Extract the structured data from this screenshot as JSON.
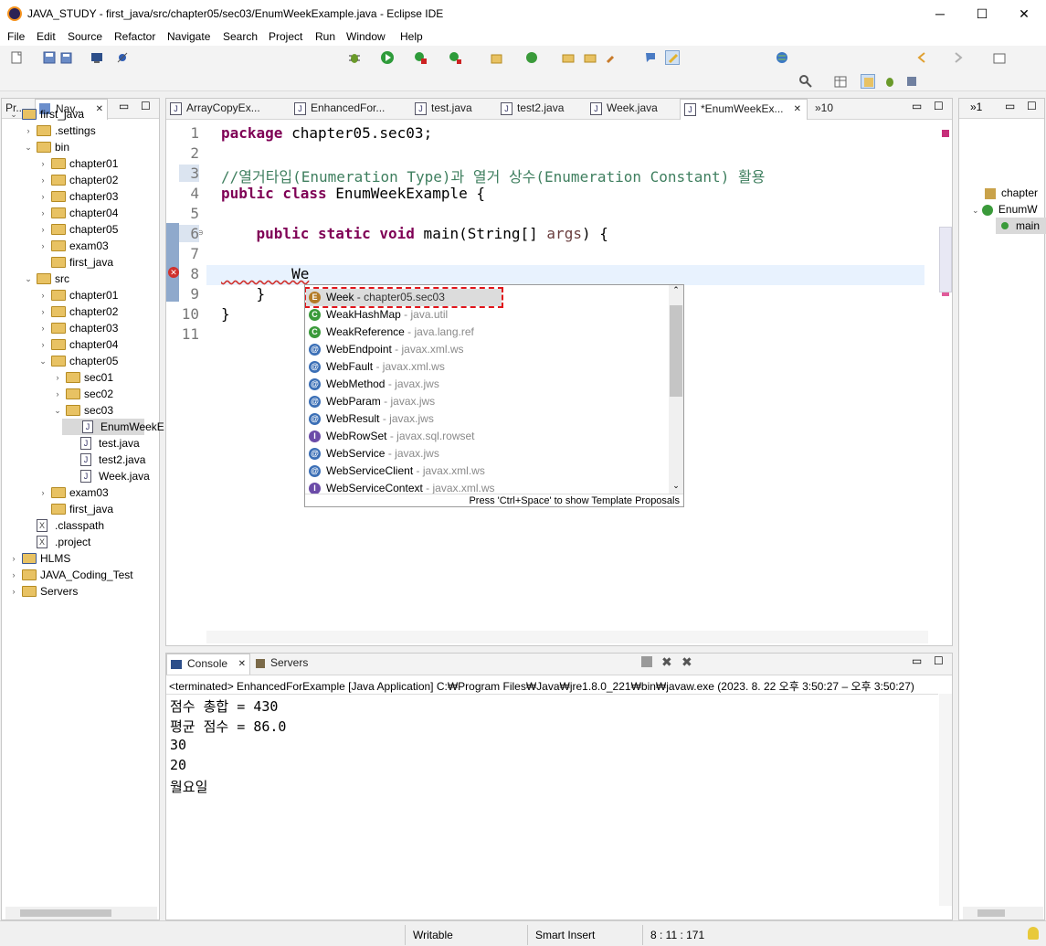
{
  "window": {
    "title": "JAVA_STUDY - first_java/src/chapter05/sec03/EnumWeekExample.java - Eclipse IDE",
    "minimize": "─",
    "maximize": "☐",
    "close": "✕"
  },
  "menu": [
    "File",
    "Edit",
    "Source",
    "Refactor",
    "Navigate",
    "Search",
    "Project",
    "Run",
    "Window",
    "Help"
  ],
  "left_panel": {
    "tabs": [
      "Pr...",
      "Nav..."
    ],
    "tree": [
      {
        "label": "first_java",
        "level": 0,
        "expanded": true,
        "kind": "project"
      },
      {
        "label": ".settings",
        "level": 1,
        "expanded": false,
        "kind": "folder"
      },
      {
        "label": "bin",
        "level": 1,
        "expanded": true,
        "kind": "folder"
      },
      {
        "label": "chapter01",
        "level": 2,
        "expanded": false,
        "kind": "folder"
      },
      {
        "label": "chapter02",
        "level": 2,
        "expanded": false,
        "kind": "folder"
      },
      {
        "label": "chapter03",
        "level": 2,
        "expanded": false,
        "kind": "folder"
      },
      {
        "label": "chapter04",
        "level": 2,
        "expanded": false,
        "kind": "folder"
      },
      {
        "label": "chapter05",
        "level": 2,
        "expanded": false,
        "kind": "folder"
      },
      {
        "label": "exam03",
        "level": 2,
        "expanded": false,
        "kind": "folder"
      },
      {
        "label": "first_java",
        "level": 2,
        "expanded": null,
        "kind": "folder"
      },
      {
        "label": "src",
        "level": 1,
        "expanded": true,
        "kind": "folder"
      },
      {
        "label": "chapter01",
        "level": 2,
        "expanded": false,
        "kind": "folder"
      },
      {
        "label": "chapter02",
        "level": 2,
        "expanded": false,
        "kind": "folder"
      },
      {
        "label": "chapter03",
        "level": 2,
        "expanded": false,
        "kind": "folder"
      },
      {
        "label": "chapter04",
        "level": 2,
        "expanded": false,
        "kind": "folder"
      },
      {
        "label": "chapter05",
        "level": 2,
        "expanded": true,
        "kind": "folder"
      },
      {
        "label": "sec01",
        "level": 3,
        "expanded": false,
        "kind": "folder"
      },
      {
        "label": "sec02",
        "level": 3,
        "expanded": false,
        "kind": "folder"
      },
      {
        "label": "sec03",
        "level": 3,
        "expanded": true,
        "kind": "folder"
      },
      {
        "label": "EnumWeekE",
        "level": 4,
        "expanded": null,
        "kind": "java",
        "selected": true
      },
      {
        "label": "test.java",
        "level": 4,
        "expanded": null,
        "kind": "java"
      },
      {
        "label": "test2.java",
        "level": 4,
        "expanded": null,
        "kind": "java"
      },
      {
        "label": "Week.java",
        "level": 4,
        "expanded": null,
        "kind": "java"
      },
      {
        "label": "exam03",
        "level": 2,
        "expanded": false,
        "kind": "folder"
      },
      {
        "label": "first_java",
        "level": 2,
        "expanded": null,
        "kind": "folder"
      },
      {
        "label": ".classpath",
        "level": 1,
        "expanded": null,
        "kind": "xml"
      },
      {
        "label": ".project",
        "level": 1,
        "expanded": null,
        "kind": "xml"
      },
      {
        "label": "HLMS",
        "level": 0,
        "expanded": false,
        "kind": "project"
      },
      {
        "label": "JAVA_Coding_Test",
        "level": 0,
        "expanded": false,
        "kind": "folder"
      },
      {
        "label": "Servers",
        "level": 0,
        "expanded": false,
        "kind": "folder"
      }
    ]
  },
  "editor": {
    "tabs": [
      "ArrayCopyEx...",
      "EnhancedFor...",
      "test.java",
      "test2.java",
      "Week.java",
      "*EnumWeekEx..."
    ],
    "overflow_count": "»10",
    "line_numbers": [
      "1",
      "2",
      "3",
      "4",
      "5",
      "6",
      "7",
      "8",
      "9",
      "10",
      "11"
    ],
    "lines": [
      {
        "k": "package",
        "r": " chapter05.sec03;"
      },
      {
        "k": "",
        "r": ""
      },
      {
        "c": "//열거타입(Enumeration Type)과 열거 상수(Enumeration Constant) 활용"
      },
      {
        "k": "public class",
        "r": " EnumWeekExample {"
      },
      {
        "k": "",
        "r": ""
      },
      {
        "k": "    public static void",
        "r": " main(String[] ",
        "p": "args",
        ") ": ""
      },
      {
        "k": "",
        "r": ""
      },
      {
        "k": "",
        "r": "        We"
      },
      {
        "k": "",
        "r": "    }"
      },
      {
        "k": "",
        "r": "}"
      },
      {
        "k": "",
        "r": ""
      }
    ],
    "line6_tail": ") {"
  },
  "assist": {
    "items": [
      {
        "name": "Week",
        "pkg": " - chapter05.sec03",
        "icon": "E",
        "color": "#b47b28",
        "selected": true
      },
      {
        "name": "WeakHashMap",
        "pkg": " - java.util",
        "icon": "C",
        "color": "#3a9a3a"
      },
      {
        "name": "WeakReference",
        "pkg": " - java.lang.ref",
        "icon": "C",
        "color": "#3a9a3a"
      },
      {
        "name": "WebEndpoint",
        "pkg": " - javax.xml.ws",
        "icon": "@",
        "color": "#3b6fb6"
      },
      {
        "name": "WebFault",
        "pkg": " - javax.xml.ws",
        "icon": "@",
        "color": "#3b6fb6"
      },
      {
        "name": "WebMethod",
        "pkg": " - javax.jws",
        "icon": "@",
        "color": "#3b6fb6"
      },
      {
        "name": "WebParam",
        "pkg": " - javax.jws",
        "icon": "@",
        "color": "#3b6fb6"
      },
      {
        "name": "WebResult",
        "pkg": " - javax.jws",
        "icon": "@",
        "color": "#3b6fb6"
      },
      {
        "name": "WebRowSet",
        "pkg": " - javax.sql.rowset",
        "icon": "I",
        "color": "#6b4ba8"
      },
      {
        "name": "WebService",
        "pkg": " - javax.jws",
        "icon": "@",
        "color": "#3b6fb6"
      },
      {
        "name": "WebServiceClient",
        "pkg": " - javax.xml.ws",
        "icon": "@",
        "color": "#3b6fb6"
      },
      {
        "name": "WebServiceContext",
        "pkg": " - javax.xml.ws",
        "icon": "I",
        "color": "#6b4ba8"
      }
    ],
    "footer": "Press 'Ctrl+Space' to show Template Proposals"
  },
  "console": {
    "tabs": [
      "Console",
      "Servers"
    ],
    "header": "<terminated> EnhancedForExample [Java Application] C:₩Program Files₩Java₩jre1.8.0_221₩bin₩javaw.exe  (2023. 8. 22 오후 3:50:27 – 오후 3:50:27)",
    "output": [
      "점수 총합 = 430",
      "평균 점수 = 86.0",
      "30",
      "20",
      "월요일"
    ]
  },
  "right_panel": {
    "tab_overflow": "»1",
    "outline": [
      "chapter",
      "EnumW",
      "main"
    ]
  },
  "status": {
    "writable": "Writable",
    "insert_mode": "Smart Insert",
    "position": "8 : 11 : 171"
  }
}
